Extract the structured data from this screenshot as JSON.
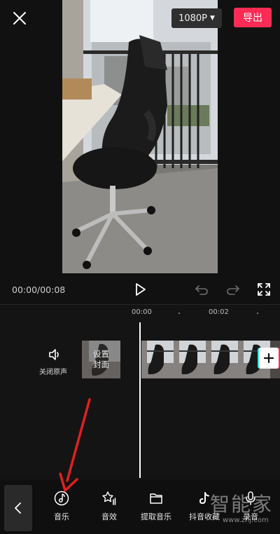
{
  "header": {
    "resolution": "1080P",
    "export_label": "导出"
  },
  "player": {
    "timecode": "00:00/00:08"
  },
  "timeline": {
    "ruler_labels": [
      "00:00",
      "00:02"
    ],
    "mute_label": "关闭原声",
    "cover_line1": "设置",
    "cover_line2": "封面"
  },
  "toolbar": {
    "items": [
      {
        "label": "音乐",
        "icon": "music-note-icon"
      },
      {
        "label": "音效",
        "icon": "sound-effect-icon"
      },
      {
        "label": "提取音乐",
        "icon": "folder-icon"
      },
      {
        "label": "抖音收藏",
        "icon": "tiktok-icon"
      },
      {
        "label": "录音",
        "icon": "microphone-icon"
      }
    ]
  },
  "watermark": {
    "text": "智能家",
    "url": "www.znj.com"
  },
  "colors": {
    "accent": "#fe2c55",
    "background": "#111111",
    "annotation_arrow": "#e02020"
  }
}
